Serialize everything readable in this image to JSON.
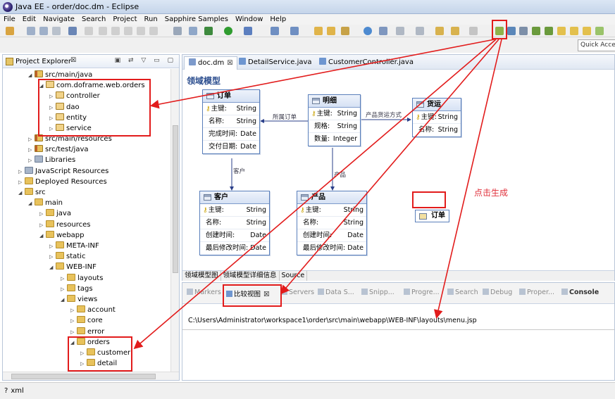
{
  "window": {
    "title": "Java EE - order/doc.dm - Eclipse"
  },
  "menu": [
    "File",
    "Edit",
    "Navigate",
    "Search",
    "Project",
    "Run",
    "Sapphire Samples",
    "Window",
    "Help"
  ],
  "quick_access": "Quick Access",
  "project_explorer": {
    "title": "Project Explorer",
    "rows": [
      {
        "label": "src/main/java",
        "icon": "src-folder-icon"
      },
      {
        "label": "com.doframe.web.orders",
        "icon": "package-icon"
      },
      {
        "label": "controller",
        "icon": "package-icon"
      },
      {
        "label": "dao",
        "icon": "package-icon"
      },
      {
        "label": "entity",
        "icon": "package-icon"
      },
      {
        "label": "service",
        "icon": "package-icon"
      },
      {
        "label": "src/main/resources",
        "icon": "src-folder-icon"
      },
      {
        "label": "src/test/java",
        "icon": "src-folder-icon"
      },
      {
        "label": "Libraries",
        "icon": "library-icon"
      },
      {
        "label": "JavaScript Resources",
        "icon": "library-icon"
      },
      {
        "label": "Deployed Resources",
        "icon": "folder-icon"
      },
      {
        "label": "src",
        "icon": "folder-icon"
      },
      {
        "label": "main",
        "icon": "folder-icon"
      },
      {
        "label": "java",
        "icon": "folder-icon"
      },
      {
        "label": "resources",
        "icon": "folder-icon"
      },
      {
        "label": "webapp",
        "icon": "folder-icon"
      },
      {
        "label": "META-INF",
        "icon": "folder-icon"
      },
      {
        "label": "static",
        "icon": "folder-icon"
      },
      {
        "label": "WEB-INF",
        "icon": "folder-icon"
      },
      {
        "label": "layouts",
        "icon": "folder-icon"
      },
      {
        "label": "tags",
        "icon": "folder-icon"
      },
      {
        "label": "views",
        "icon": "folder-icon"
      },
      {
        "label": "account",
        "icon": "folder-icon"
      },
      {
        "label": "core",
        "icon": "folder-icon"
      },
      {
        "label": "error",
        "icon": "folder-icon"
      },
      {
        "label": "orders",
        "icon": "folder-icon"
      },
      {
        "label": "customer",
        "icon": "folder-icon"
      },
      {
        "label": "detail",
        "icon": "folder-icon"
      }
    ]
  },
  "editor": {
    "tabs": [
      "doc.dm",
      "DetailService.java",
      "CustomerController.java"
    ],
    "diagram_title": "领域模型",
    "entities": {
      "order": {
        "name": "订单",
        "fields": [
          {
            "name": "主键:",
            "type": "String",
            "key": true
          },
          {
            "name": "名称:",
            "type": "String"
          },
          {
            "name": "完成时间:",
            "type": "Date"
          },
          {
            "name": "交付日期:",
            "type": "Date"
          }
        ]
      },
      "detail": {
        "name": "明细",
        "fields": [
          {
            "name": "主键:",
            "type": "String",
            "key": true
          },
          {
            "name": "规格:",
            "type": "String"
          },
          {
            "name": "数量:",
            "type": "Integer"
          }
        ]
      },
      "shipping": {
        "name": "货运",
        "fields": [
          {
            "name": "主键:",
            "type": "String",
            "key": true
          },
          {
            "name": "名称:",
            "type": "String"
          }
        ]
      },
      "customer": {
        "name": "客户",
        "fields": [
          {
            "name": "主键:",
            "type": "String",
            "key": true
          },
          {
            "name": "名称:",
            "type": "String"
          },
          {
            "name": "创建时间:",
            "type": "Date"
          },
          {
            "name": "最后修改时间:",
            "type": "Date"
          }
        ]
      },
      "product": {
        "name": "产品",
        "fields": [
          {
            "name": "主键:",
            "type": "String",
            "key": true
          },
          {
            "name": "名称:",
            "type": "String"
          },
          {
            "name": "创建时间:",
            "type": "Date"
          },
          {
            "name": "最后修改时间:",
            "type": "Date"
          }
        ]
      }
    },
    "relations": {
      "order_detail": "所属订单",
      "detail_shipping": "产品货运方式",
      "order_customer": "客户",
      "detail_product": "产品"
    },
    "order_chip": "订单",
    "note": "点击生成",
    "canvas_tabs": [
      "领域模型图",
      "领域模型详细信息",
      "Source"
    ]
  },
  "bottom_panel": {
    "tabs": [
      "Markers",
      "比较视图",
      "Servers",
      "Data S...",
      "Snipp...",
      "Progre...",
      "Search",
      "Debug",
      "Proper...",
      "Console"
    ],
    "path": "C:\\Users\\Administrator\\workspace1\\order\\src\\main\\webapp\\WEB-INF\\layouts\\menu.jsp"
  },
  "status": {
    "text": "xml"
  },
  "colors": {
    "highlight": "#e21c1c",
    "entity_border": "#5a7fbb",
    "note": "#e0303b"
  }
}
